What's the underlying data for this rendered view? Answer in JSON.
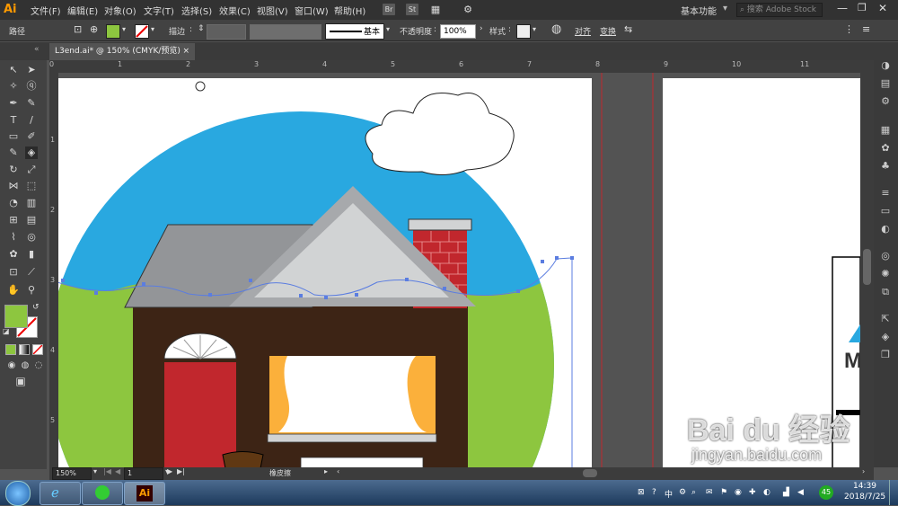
{
  "app": {
    "logo": "Ai"
  },
  "menu": {
    "items": [
      "文件(F)",
      "编辑(E)",
      "对象(O)",
      "文字(T)",
      "选择(S)",
      "效果(C)",
      "视图(V)",
      "窗口(W)",
      "帮助(H)"
    ],
    "bridge_btn": "Br",
    "stock_btn": "St",
    "workspace": "基本功能",
    "search_placeholder": "搜索 Adobe Stock"
  },
  "controlbar": {
    "object_type": "路径",
    "stroke_label": "描边",
    "stroke_style": "基本",
    "opacity_label": "不透明度",
    "opacity_value": "100%",
    "style_label": "样式",
    "align_label": "对齐",
    "transform_label": "变换",
    "fill_color": "#8dc63f"
  },
  "document": {
    "tab_title": "L3end.ai* @ 150% (CMYK/预览)",
    "close": "×"
  },
  "rulers": {
    "top": [
      "0",
      "1",
      "2",
      "3",
      "4",
      "5",
      "6",
      "7",
      "8",
      "9",
      "10",
      "11"
    ],
    "left": [
      "1",
      "2",
      "3",
      "4",
      "5"
    ]
  },
  "status": {
    "zoom": "150%",
    "artboard": "1",
    "tool": "橡皮擦"
  },
  "taskbar": {
    "ai_label": "Ai",
    "time": "14:39",
    "date": "2018/7/25",
    "ime": "中",
    "badge": "45"
  },
  "artwork": {
    "sky_color": "#29a8e0",
    "grass_color": "#8dc63f",
    "house_color": "#3d2415",
    "door_color": "#c1272d",
    "chimney_color": "#c1272d",
    "curtain_color": "#fbb03b",
    "roof_color": "#a7a9ac",
    "gable_color": "#d1d3d4"
  },
  "watermark": {
    "line1": "Bai du 经验",
    "line2": "jingyan.baidu.com"
  }
}
